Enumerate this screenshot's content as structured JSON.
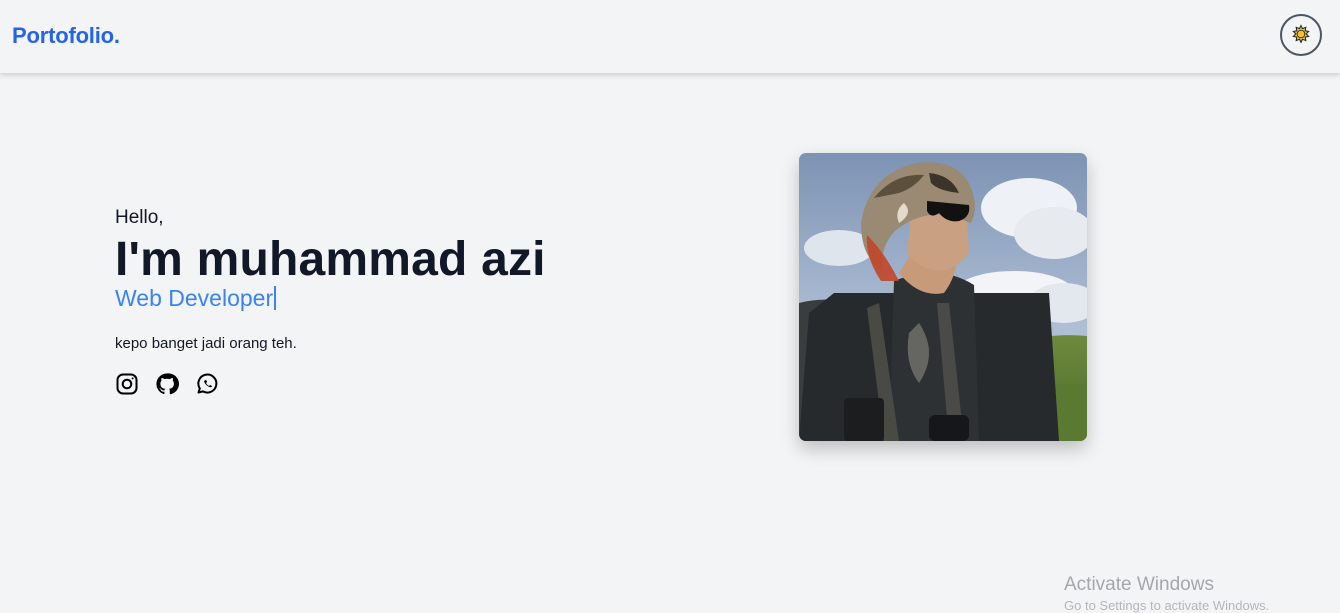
{
  "navbar": {
    "brand": "Portofolio.",
    "theme_toggle_icon": "sun-icon"
  },
  "hero": {
    "greeting": "Hello,",
    "headline": "I'm muhammad azi",
    "role": "Web Developer",
    "tagline": "kepo banget jadi orang teh.",
    "socials": [
      {
        "icon": "instagram-icon"
      },
      {
        "icon": "github-icon"
      },
      {
        "icon": "whatsapp-icon"
      }
    ],
    "photo_icon": "profile-photo"
  },
  "os_watermark": {
    "title": "Activate Windows",
    "subtitle": "Go to Settings to activate Windows."
  },
  "colors": {
    "accent": "#2563eb",
    "role_text": "#3b82f6",
    "background": "#f3f4f6",
    "text": "#111827"
  }
}
